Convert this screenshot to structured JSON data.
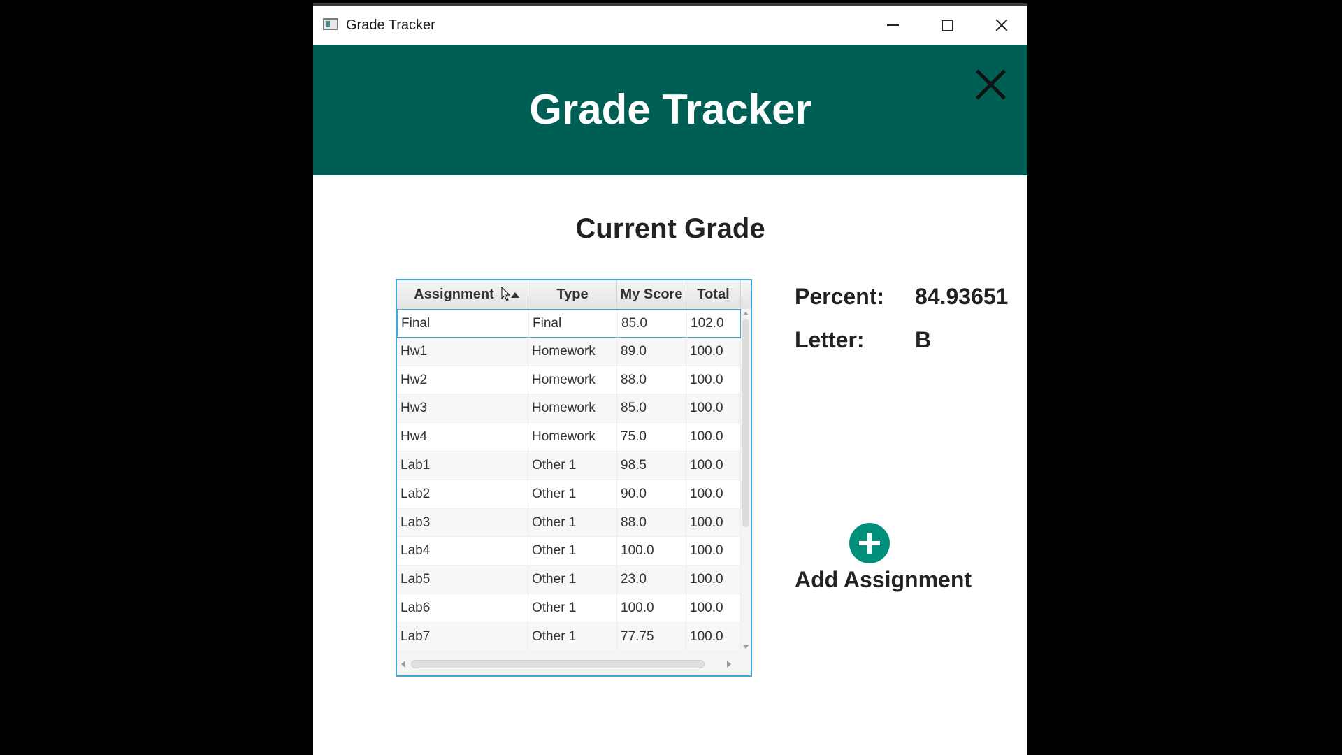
{
  "window": {
    "title": "Grade Tracker"
  },
  "header": {
    "title": "Grade Tracker"
  },
  "main": {
    "section_title": "Current Grade",
    "table": {
      "columns": [
        "Assignment",
        "Type",
        "My Score",
        "Total"
      ],
      "sort_column": "Assignment",
      "sort_direction": "ascending",
      "rows": [
        {
          "assignment": "Final",
          "type": "Final",
          "score": "85.0",
          "total": "102.0"
        },
        {
          "assignment": "Hw1",
          "type": "Homework",
          "score": "89.0",
          "total": "100.0"
        },
        {
          "assignment": "Hw2",
          "type": "Homework",
          "score": "88.0",
          "total": "100.0"
        },
        {
          "assignment": "Hw3",
          "type": "Homework",
          "score": "85.0",
          "total": "100.0"
        },
        {
          "assignment": "Hw4",
          "type": "Homework",
          "score": "75.0",
          "total": "100.0"
        },
        {
          "assignment": "Lab1",
          "type": "Other 1",
          "score": "98.5",
          "total": "100.0"
        },
        {
          "assignment": "Lab2",
          "type": "Other 1",
          "score": "90.0",
          "total": "100.0"
        },
        {
          "assignment": "Lab3",
          "type": "Other 1",
          "score": "88.0",
          "total": "100.0"
        },
        {
          "assignment": "Lab4",
          "type": "Other 1",
          "score": "100.0",
          "total": "100.0"
        },
        {
          "assignment": "Lab5",
          "type": "Other 1",
          "score": "23.0",
          "total": "100.0"
        },
        {
          "assignment": "Lab6",
          "type": "Other 1",
          "score": "100.0",
          "total": "100.0"
        },
        {
          "assignment": "Lab7",
          "type": "Other 1",
          "score": "77.75",
          "total": "100.0"
        }
      ]
    },
    "stats": {
      "percent_label": "Percent:",
      "percent_value": "84.93651",
      "letter_label": "Letter:",
      "letter_value": "B"
    },
    "add_button": {
      "label": "Add Assignment"
    }
  },
  "colors": {
    "header_bg": "#005f55",
    "add_button": "#008f7a",
    "table_focus_border": "#3ea8d8"
  },
  "icons": [
    "app-icon",
    "minimize-icon",
    "maximize-icon",
    "close-icon",
    "header-close-icon",
    "sort-ascending-icon",
    "mouse-cursor-icon",
    "plus-icon"
  ]
}
